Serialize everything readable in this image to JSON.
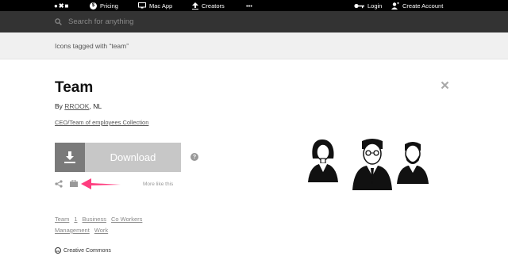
{
  "nav": {
    "logo": "●✖■",
    "pricing": "Pricing",
    "pricing_icon": "$",
    "mac_app": "Mac App",
    "creators": "Creators",
    "more": "•••",
    "login": "Login",
    "create_account": "Create Account"
  },
  "search": {
    "placeholder": "Search for anything"
  },
  "tagbar": {
    "text": "Icons tagged with “team”"
  },
  "icon": {
    "title": "Team",
    "by_prefix": "By",
    "author": "RROOK",
    "author_suffix": ", NL",
    "collection": "CEO/Team of employees Collection",
    "download_label": "Download",
    "help": "?",
    "more_like_this": "More like this"
  },
  "tags": [
    [
      "Team",
      "1",
      "Business",
      "Co Workers"
    ],
    [
      "Management",
      "Work"
    ]
  ],
  "license": {
    "icon": "cc",
    "label": "Creative Commons"
  },
  "colors": {
    "pointer": "#ff3d7f",
    "topbar": "#000000",
    "search_bg": "#333333",
    "download_dark": "#7a7a7a",
    "download_light": "#c7c7c7"
  }
}
